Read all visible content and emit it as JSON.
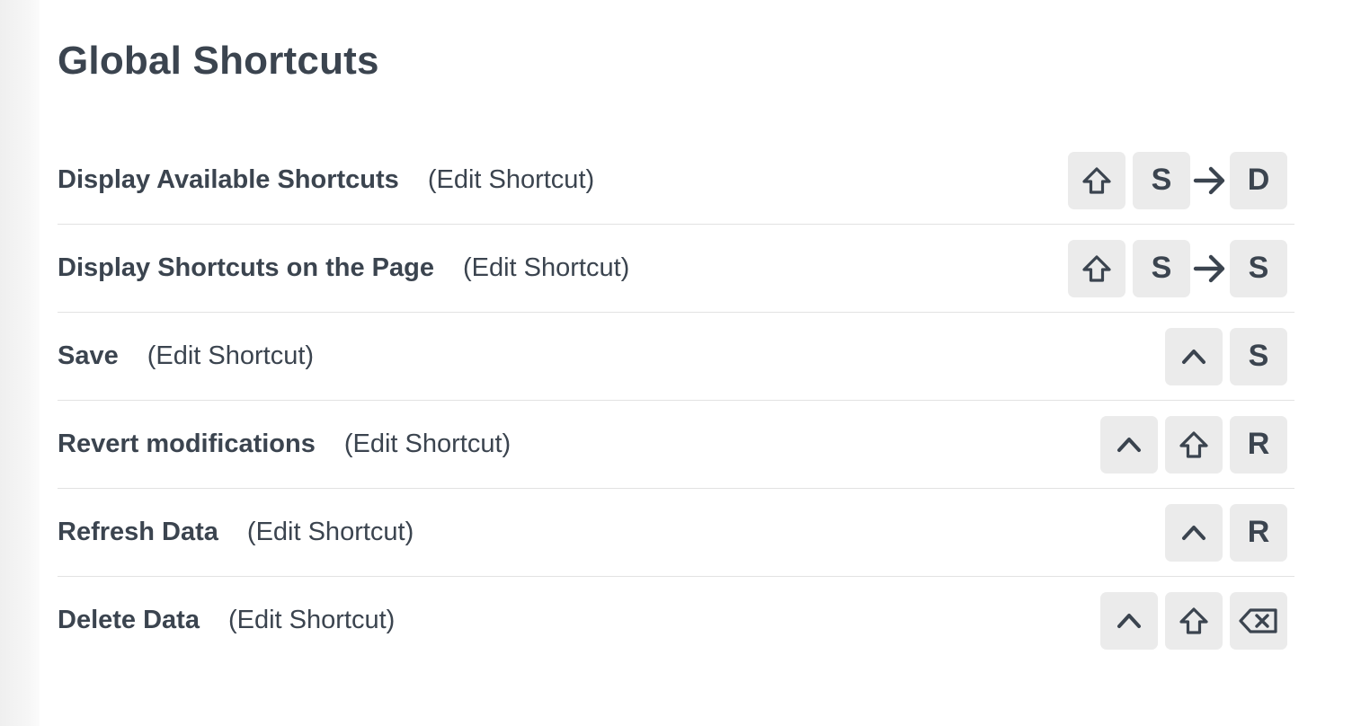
{
  "page": {
    "title": "Global Shortcuts"
  },
  "shortcuts": [
    {
      "name": "Display Available Shortcuts",
      "edit_label": "(Edit Shortcut)",
      "keys": [
        {
          "type": "icon",
          "icon": "shift-icon"
        },
        {
          "type": "text",
          "label": "S"
        },
        {
          "type": "then",
          "icon": "arrow-right-icon"
        },
        {
          "type": "text",
          "label": "D"
        }
      ]
    },
    {
      "name": "Display Shortcuts on the Page",
      "edit_label": "(Edit Shortcut)",
      "keys": [
        {
          "type": "icon",
          "icon": "shift-icon"
        },
        {
          "type": "text",
          "label": "S"
        },
        {
          "type": "then",
          "icon": "arrow-right-icon"
        },
        {
          "type": "text",
          "label": "S"
        }
      ]
    },
    {
      "name": "Save",
      "edit_label": "(Edit Shortcut)",
      "keys": [
        {
          "type": "icon",
          "icon": "control-icon"
        },
        {
          "type": "text",
          "label": "S"
        }
      ]
    },
    {
      "name": "Revert modifications",
      "edit_label": "(Edit Shortcut)",
      "keys": [
        {
          "type": "icon",
          "icon": "control-icon"
        },
        {
          "type": "icon",
          "icon": "shift-icon"
        },
        {
          "type": "text",
          "label": "R"
        }
      ]
    },
    {
      "name": "Refresh Data",
      "edit_label": "(Edit Shortcut)",
      "keys": [
        {
          "type": "icon",
          "icon": "control-icon"
        },
        {
          "type": "text",
          "label": "R"
        }
      ]
    },
    {
      "name": "Delete Data",
      "edit_label": "(Edit Shortcut)",
      "keys": [
        {
          "type": "icon",
          "icon": "control-icon"
        },
        {
          "type": "icon",
          "icon": "shift-icon"
        },
        {
          "type": "icon",
          "icon": "backspace-icon"
        }
      ]
    }
  ],
  "colors": {
    "text": "#3b444f",
    "key_background": "#ebebeb",
    "divider": "#e2e2e2"
  }
}
